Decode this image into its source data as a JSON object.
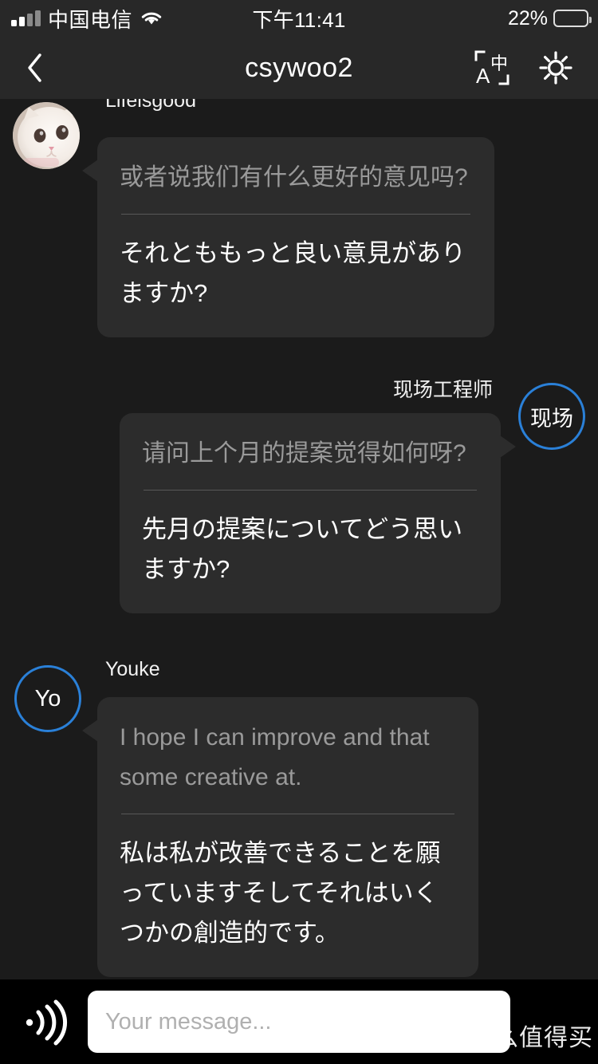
{
  "statusbar": {
    "carrier": "中国电信",
    "time": "下午11:41",
    "battery_pct": "22%",
    "signal_icon": "signal-bars-icon",
    "wifi_icon": "wifi-icon",
    "battery_icon": "battery-icon"
  },
  "header": {
    "title": "csywoo2",
    "back_icon": "chevron-left-icon",
    "translate_icon": "translate-a-chinese-icon",
    "settings_icon": "gear-icon"
  },
  "messages": [
    {
      "sender": "Lifeisgood",
      "side": "left",
      "avatar_type": "photo",
      "avatar_label": "",
      "source_text": "或者说我们有什么更好的意见吗?",
      "translated_text": "それとももっと良い意見がありますか?"
    },
    {
      "sender": "现场工程师",
      "side": "right",
      "avatar_type": "initials",
      "avatar_label": "现场",
      "source_text": "请问上个月的提案觉得如何呀?",
      "translated_text": "先月の提案についてどう思いますか?"
    },
    {
      "sender": "Youke",
      "side": "left",
      "avatar_type": "initials",
      "avatar_label": "Yo",
      "source_text": "I hope I can improve and that some creative at.",
      "translated_text": "私は私が改善できることを願っていますそしてそれはいくつかの創造的です。"
    }
  ],
  "composer": {
    "voice_icon": "voice-wave-icon",
    "input_placeholder": "Your message...",
    "input_value": ""
  },
  "watermark": {
    "logo_text": "值",
    "text": "什么值得买"
  },
  "colors": {
    "background": "#1b1b1b",
    "header": "#282828",
    "bubble": "#2c2c2c",
    "accent_blue": "#2a80d8",
    "source_text": "#9a9a9a",
    "translated_text": "#ffffff"
  }
}
